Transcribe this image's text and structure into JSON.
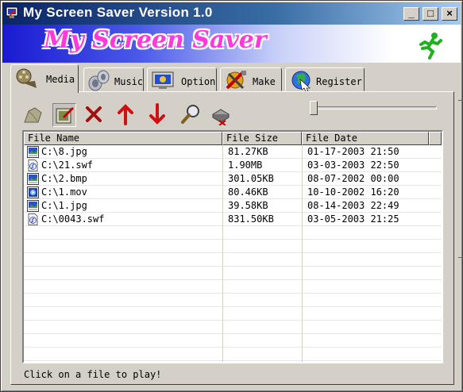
{
  "window": {
    "title": "My Screen Saver Version 1.0",
    "controls": {
      "minimize": "_",
      "restore": "□",
      "close": "×"
    }
  },
  "banner": {
    "logo_text": "My Screen Saver",
    "accent_color": "#ff3ad8"
  },
  "tabs": [
    {
      "label": "Media",
      "icon": "media-film-icon",
      "active": true
    },
    {
      "label": "Music",
      "icon": "music-speaker-icon",
      "active": false
    },
    {
      "label": "Option",
      "icon": "option-monitor-icon",
      "active": false
    },
    {
      "label": "Make",
      "icon": "make-tools-icon",
      "active": false
    },
    {
      "label": "Register",
      "icon": "register-globe-icon",
      "active": false
    }
  ],
  "toolbar": {
    "buttons": [
      "open-folder-icon",
      "edit-picture-icon",
      "delete-x-icon",
      "move-up-arrow-icon",
      "move-down-arrow-icon",
      "search-magnifier-icon",
      "clear-drive-icon"
    ],
    "slider_value": 0
  },
  "file_list": {
    "columns": [
      "File Name",
      "File Size",
      "File Date"
    ],
    "rows": [
      {
        "name": "C:\\8.jpg",
        "size": "81.27KB",
        "date": "01-17-2003 21:50",
        "type": "image"
      },
      {
        "name": "C:\\21.swf",
        "size": "1.90MB",
        "date": "03-03-2003 22:50",
        "type": "flash"
      },
      {
        "name": "C:\\2.bmp",
        "size": "301.05KB",
        "date": "08-07-2002 00:00",
        "type": "image"
      },
      {
        "name": "C:\\1.mov",
        "size": "80.46KB",
        "date": "10-10-2002 16:20",
        "type": "video"
      },
      {
        "name": "C:\\1.jpg",
        "size": "39.58KB",
        "date": "08-14-2003 22:49",
        "type": "image"
      },
      {
        "name": "C:\\0043.swf",
        "size": "831.50KB",
        "date": "03-05-2003 21:25",
        "type": "flash"
      }
    ]
  },
  "status": {
    "text": "Click on a file to play!"
  }
}
